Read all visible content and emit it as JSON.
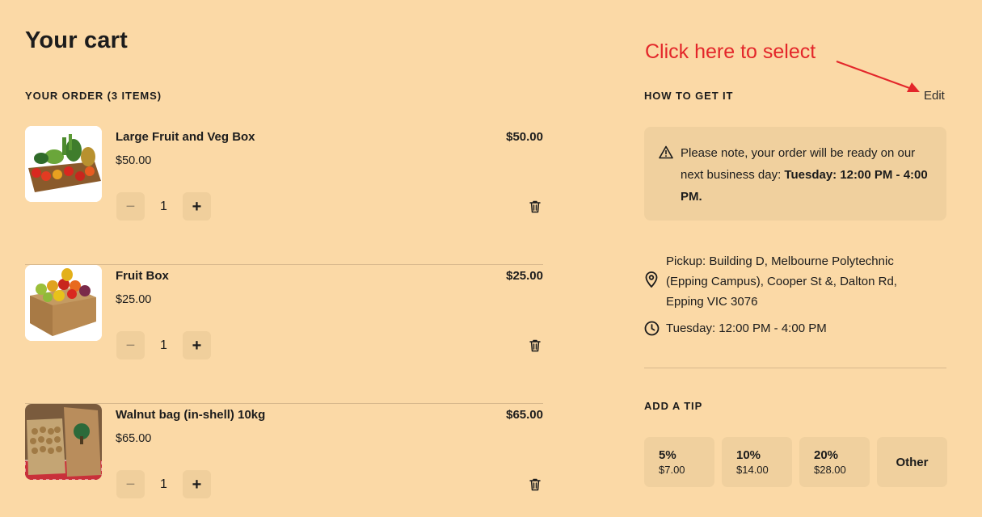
{
  "page": {
    "title": "Your cart"
  },
  "order": {
    "heading": "YOUR ORDER (3 ITEMS)",
    "items": [
      {
        "name": "Large Fruit and Veg Box",
        "unit_price": "$50.00",
        "total": "$50.00",
        "quantity": "1"
      },
      {
        "name": "Fruit Box",
        "unit_price": "$25.00",
        "total": "$25.00",
        "quantity": "1"
      },
      {
        "name": "Walnut bag (in-shell) 10kg",
        "unit_price": "$65.00",
        "total": "$65.00",
        "quantity": "1"
      }
    ],
    "minus_symbol": "−",
    "plus_symbol": "+"
  },
  "fulfillment": {
    "heading": "HOW TO GET IT",
    "edit_label": "Edit",
    "notice_prefix": "Please note, your order will be ready on our next business day: ",
    "notice_time": "Tuesday: 12:00 PM - 4:00 PM.",
    "pickup_address": "Pickup: Building D, Melbourne Polytechnic (Epping Campus), Cooper St &, Dalton Rd, Epping VIC 3076",
    "pickup_time": "Tuesday: 12:00 PM - 4:00 PM"
  },
  "annotation": {
    "text": "Click here to select",
    "color": "#e3262a"
  },
  "tip": {
    "heading": "ADD A TIP",
    "options": [
      {
        "percent": "5%",
        "amount": "$7.00"
      },
      {
        "percent": "10%",
        "amount": "$14.00"
      },
      {
        "percent": "20%",
        "amount": "$28.00"
      }
    ],
    "other_label": "Other"
  },
  "colors": {
    "background": "#fbd9a6",
    "panel": "#f0d09e",
    "button": "#f0cf9c",
    "divider": "#d8b98d"
  },
  "icons": [
    "trash-icon",
    "warning-icon",
    "location-pin-icon",
    "clock-icon"
  ]
}
